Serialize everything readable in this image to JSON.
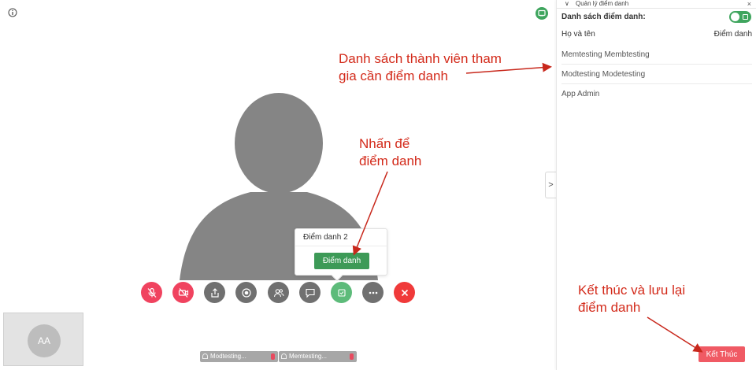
{
  "panel": {
    "header_title": "Quản lý điểm danh",
    "header_chevron": "∨",
    "close_glyph": "×",
    "list_label": "Danh sách điểm danh:",
    "col_name": "Họ và tên",
    "col_attendance": "Điểm danh",
    "members": [
      "Memtesting Membtesting",
      "Modtesting Modetesting",
      "App Admin"
    ],
    "end_button": "Kết Thúc"
  },
  "popover": {
    "title": "Điểm danh 2",
    "button": "Điểm danh"
  },
  "self_view": {
    "initials": "AA"
  },
  "thumbnails": [
    "Modtesting...",
    "Memtesting..."
  ],
  "collapse_glyph": ">",
  "annotations": {
    "members_note": [
      "Danh sách thành viên tham",
      "gia cần điểm danh"
    ],
    "click_note": [
      "Nhấn để",
      "điểm danh"
    ],
    "end_note": [
      "Kết thúc và lưu lại",
      "điểm danh"
    ]
  },
  "icons": {
    "info": "info-icon",
    "chat": "chat-icon",
    "mic": "mic-off-icon",
    "camera": "camera-off-icon",
    "share": "share-icon",
    "record": "record-icon",
    "participants": "participants-icon",
    "chat_toolbar": "chat-bubble-icon",
    "attendance": "attendance-icon",
    "more": "more-icon",
    "end_call": "end-call-icon"
  },
  "colors": {
    "green": "#3d9a57",
    "red_mute": "#f0435f",
    "annotation_red": "#d32a1a",
    "end_red": "#f05a64"
  }
}
